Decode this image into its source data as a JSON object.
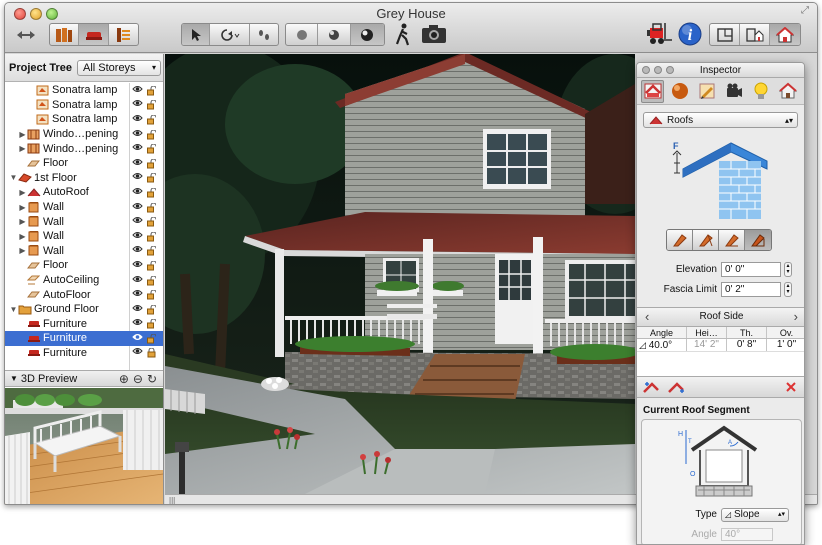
{
  "window": {
    "title": "Grey House",
    "fullscreen_glyph": "⤢"
  },
  "toolbar": {
    "left_icons": [
      "back-forward-icon",
      "library-icon",
      "furniture-icon",
      "inspector-list-icon"
    ],
    "tools": [
      "pointer-icon",
      "rotate-icon",
      "footprints-icon"
    ],
    "view_modes": [
      "sphere-flat-icon",
      "sphere-shaded-icon",
      "sphere-render-icon"
    ],
    "walk_icon": "walker-icon",
    "camera_icon": "camera-icon",
    "right_icons": [
      "forklift-icon",
      "info-icon",
      "plan-view-icon",
      "split-view-icon",
      "3d-view-icon"
    ]
  },
  "project_tree": {
    "label": "Project Tree",
    "storey_filter": "All Storeys",
    "items": [
      {
        "label": "Sonatra lamp",
        "indent": 2,
        "disclosure": "",
        "icon": "lamp-icon",
        "locked": false,
        "selected": false
      },
      {
        "label": "Sonatra lamp",
        "indent": 2,
        "disclosure": "",
        "icon": "lamp-icon",
        "locked": false,
        "selected": false
      },
      {
        "label": "Sonatra lamp",
        "indent": 2,
        "disclosure": "",
        "icon": "lamp-icon",
        "locked": false,
        "selected": false
      },
      {
        "label": "Windo…pening",
        "indent": 1,
        "disclosure": "▶",
        "icon": "window-icon",
        "locked": false,
        "selected": false
      },
      {
        "label": "Windo…pening",
        "indent": 1,
        "disclosure": "▶",
        "icon": "window-icon",
        "locked": false,
        "selected": false
      },
      {
        "label": "Floor",
        "indent": 1,
        "disclosure": "",
        "icon": "floor-icon",
        "locked": false,
        "selected": false
      },
      {
        "label": "1st Floor",
        "indent": 0,
        "disclosure": "▼",
        "icon": "storey-icon",
        "locked": false,
        "selected": false
      },
      {
        "label": "AutoRoof",
        "indent": 1,
        "disclosure": "▶",
        "icon": "roof-icon",
        "locked": false,
        "selected": false
      },
      {
        "label": "Wall",
        "indent": 1,
        "disclosure": "▶",
        "icon": "wall-icon",
        "locked": false,
        "selected": false
      },
      {
        "label": "Wall",
        "indent": 1,
        "disclosure": "▶",
        "icon": "wall-icon",
        "locked": false,
        "selected": false
      },
      {
        "label": "Wall",
        "indent": 1,
        "disclosure": "▶",
        "icon": "wall-icon",
        "locked": false,
        "selected": false
      },
      {
        "label": "Wall",
        "indent": 1,
        "disclosure": "▶",
        "icon": "wall-icon",
        "locked": false,
        "selected": false
      },
      {
        "label": "Floor",
        "indent": 1,
        "disclosure": "",
        "icon": "floor-icon",
        "locked": false,
        "selected": false
      },
      {
        "label": "AutoCeiling",
        "indent": 1,
        "disclosure": "",
        "icon": "ceiling-icon",
        "locked": false,
        "selected": false
      },
      {
        "label": "AutoFloor",
        "indent": 1,
        "disclosure": "",
        "icon": "floor-icon",
        "locked": false,
        "selected": false
      },
      {
        "label": "Ground Floor",
        "indent": 0,
        "disclosure": "▼",
        "icon": "folder-icon",
        "locked": false,
        "selected": false
      },
      {
        "label": "Furniture",
        "indent": 1,
        "disclosure": "",
        "icon": "furniture-icon",
        "locked": false,
        "selected": false
      },
      {
        "label": "Furniture",
        "indent": 1,
        "disclosure": "",
        "icon": "furniture-icon",
        "locked": false,
        "selected": true
      },
      {
        "label": "Furniture",
        "indent": 1,
        "disclosure": "",
        "icon": "furniture-icon",
        "locked": true,
        "selected": false
      }
    ]
  },
  "preview": {
    "label": "3D Preview",
    "zoom_in": "⊕",
    "zoom_out": "⊖",
    "rotate": "↻"
  },
  "inspector": {
    "title": "Inspector",
    "tabs": [
      "roof-tab-icon",
      "material-sphere-icon",
      "pencil-icon",
      "camera-tab-icon",
      "light-bulb-icon",
      "house-tab-icon"
    ],
    "object_type": "Roofs",
    "diagram_label": "F",
    "elevation_label": "Elevation",
    "elevation_value": "0' 0\"",
    "fascia_label": "Fascia Limit",
    "fascia_value": "0' 2\"",
    "roof_side": {
      "title": "Roof Side",
      "prev": "‹",
      "next": "›",
      "columns": [
        "Angle",
        "Hei…",
        "Th.",
        "Ov."
      ],
      "rows": [
        [
          "40.0°",
          "14' 2\"",
          "0' 8\"",
          "1' 0\""
        ]
      ]
    },
    "current_segment": {
      "title": "Current Roof Segment",
      "type_label": "Type",
      "type_value": "Slope",
      "angle_label": "Angle",
      "angle_value": "40°",
      "diagram_labels": [
        "H",
        "T",
        "A",
        "O"
      ]
    }
  },
  "colors": {
    "selection": "#3c6ed1",
    "roof_red": "#c23a2c",
    "diagram_blue": "#3a86d8",
    "brick_blue": "#8fc4f0"
  }
}
